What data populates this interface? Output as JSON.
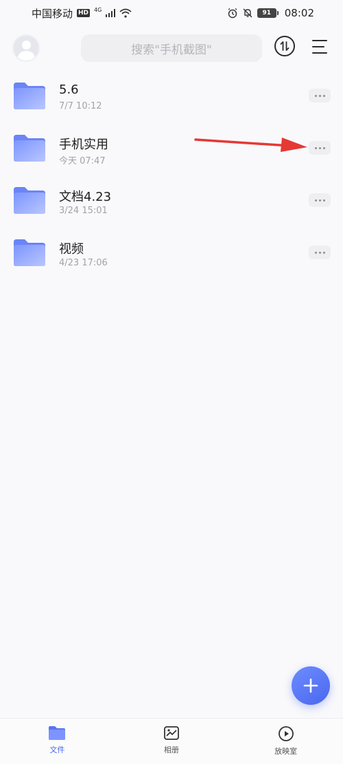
{
  "status_bar": {
    "carrier": "中国移动",
    "hd": "HD",
    "network": "4G",
    "battery": "91",
    "time": "08:02"
  },
  "header": {
    "search_placeholder": "搜索\"手机截图\""
  },
  "folders": [
    {
      "name": "5.6",
      "date": "7/7 10:12"
    },
    {
      "name": "手机实用",
      "date": "今天 07:47"
    },
    {
      "name": "文档4.23",
      "date": "3/24 15:01"
    },
    {
      "name": "视频",
      "date": "4/23 17:06"
    }
  ],
  "bottom_nav": [
    {
      "label": "文件",
      "icon": "folder-icon",
      "active": true
    },
    {
      "label": "相册",
      "icon": "album-icon",
      "active": false
    },
    {
      "label": "放映室",
      "icon": "play-icon",
      "active": false
    }
  ],
  "colors": {
    "accent": "#4a67ee",
    "annotation": "#e53935"
  }
}
